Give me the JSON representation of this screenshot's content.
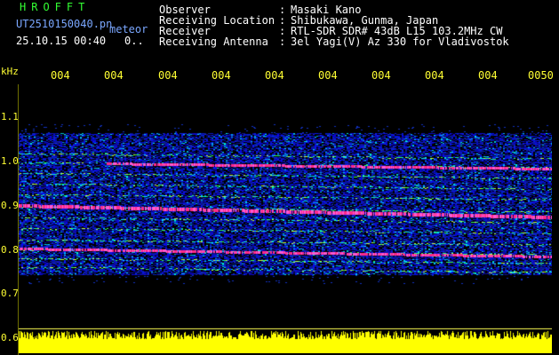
{
  "header": {
    "app_title": "HROFFT",
    "file_name": "UT2510150040.pn",
    "file_tag": "meteor",
    "datetime": "25.10.15 00:40",
    "more": "0..",
    "fields": [
      {
        "label": "Observer",
        "value": "Masaki Kano"
      },
      {
        "label": "Receiving Location",
        "value": "Shibukawa, Gunma, Japan"
      },
      {
        "label": "Receiver",
        "value": "RTL-SDR SDR# 43dB L15 103.2MHz CW"
      },
      {
        "label": "Receiving Antenna",
        "value": "3el Yagi(V) Az 330 for Vladivostok"
      }
    ],
    "separator": ":"
  },
  "axis": {
    "unit": "kHz",
    "time_ticks": [
      "004",
      "004",
      "004",
      "004",
      "004",
      "004",
      "004",
      "004",
      "004",
      "0050"
    ],
    "freq_ticks": [
      "1.1",
      "1.0",
      "0.9",
      "0.8",
      "0.7",
      "0.6"
    ]
  },
  "colors": {
    "background": "#000000",
    "label_yellow": "#ffff33",
    "title_green": "#33ff33",
    "noise_blue": "#0a1fd0",
    "signal_magenta": "#ff2a8a"
  }
}
